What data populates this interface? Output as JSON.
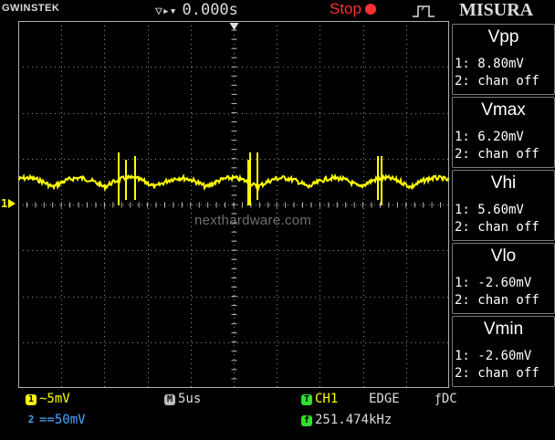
{
  "topbar": {
    "brand": "GWINSTEK",
    "timebase_offset": "0.000s",
    "run_state": "Stop",
    "menu_title": "MISURA"
  },
  "screen": {
    "channel_marker": "1",
    "watermark": "nexthardware.com",
    "trace_color": "#ffff00",
    "grid_color": "#8a8a8a"
  },
  "measurements": [
    {
      "title": "Vpp",
      "ch1": "1: 8.80mV",
      "ch2": "2: chan off"
    },
    {
      "title": "Vmax",
      "ch1": "1: 6.20mV",
      "ch2": "2: chan off"
    },
    {
      "title": "Vhi",
      "ch1": "1: 5.60mV",
      "ch2": "2: chan off"
    },
    {
      "title": "Vlo",
      "ch1": "1: -2.60mV",
      "ch2": "2: chan off"
    },
    {
      "title": "Vmin",
      "ch1": "1: -2.60mV",
      "ch2": "2: chan off"
    }
  ],
  "status": {
    "ch1_badge": "1",
    "ch1_scale": "~5mV",
    "ch2_badge": "2",
    "ch2_scale": "==50mV",
    "time_badge": "M",
    "time_scale": "5us",
    "trig_badge": "T",
    "trig_source": "CH1",
    "trig_type": "EDGE",
    "trig_coupling": "DC",
    "freq_badge": "f",
    "frequency": "251.474kHz"
  }
}
